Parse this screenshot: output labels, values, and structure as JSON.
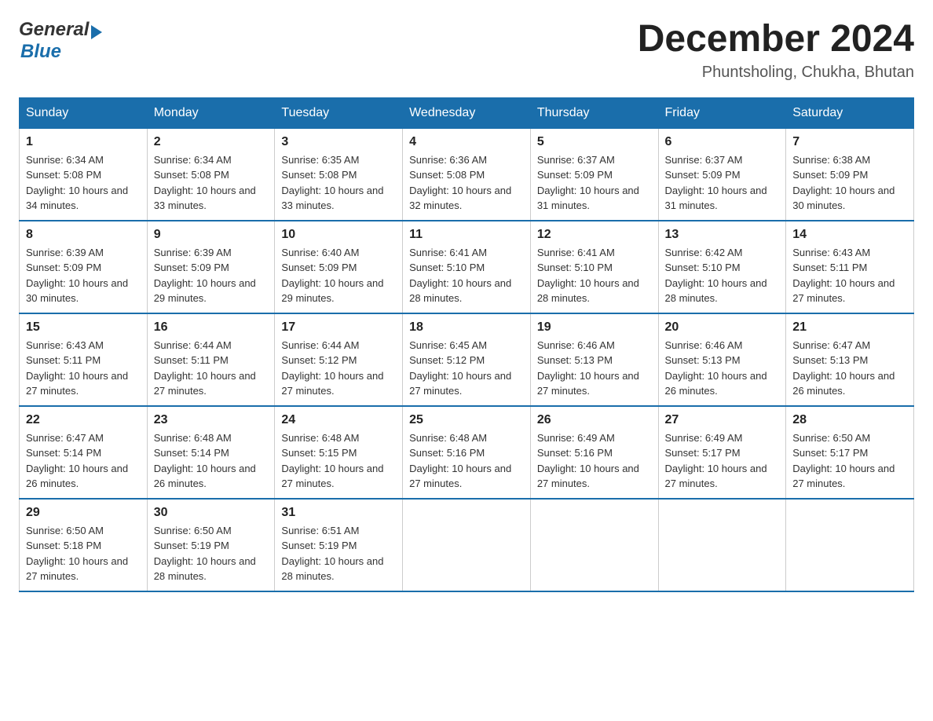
{
  "header": {
    "logo_general": "General",
    "logo_blue": "Blue",
    "title": "December 2024",
    "location": "Phuntsholing, Chukha, Bhutan"
  },
  "days_of_week": [
    "Sunday",
    "Monday",
    "Tuesday",
    "Wednesday",
    "Thursday",
    "Friday",
    "Saturday"
  ],
  "weeks": [
    [
      {
        "day": "1",
        "sunrise": "6:34 AM",
        "sunset": "5:08 PM",
        "daylight": "10 hours and 34 minutes."
      },
      {
        "day": "2",
        "sunrise": "6:34 AM",
        "sunset": "5:08 PM",
        "daylight": "10 hours and 33 minutes."
      },
      {
        "day": "3",
        "sunrise": "6:35 AM",
        "sunset": "5:08 PM",
        "daylight": "10 hours and 33 minutes."
      },
      {
        "day": "4",
        "sunrise": "6:36 AM",
        "sunset": "5:08 PM",
        "daylight": "10 hours and 32 minutes."
      },
      {
        "day": "5",
        "sunrise": "6:37 AM",
        "sunset": "5:09 PM",
        "daylight": "10 hours and 31 minutes."
      },
      {
        "day": "6",
        "sunrise": "6:37 AM",
        "sunset": "5:09 PM",
        "daylight": "10 hours and 31 minutes."
      },
      {
        "day": "7",
        "sunrise": "6:38 AM",
        "sunset": "5:09 PM",
        "daylight": "10 hours and 30 minutes."
      }
    ],
    [
      {
        "day": "8",
        "sunrise": "6:39 AM",
        "sunset": "5:09 PM",
        "daylight": "10 hours and 30 minutes."
      },
      {
        "day": "9",
        "sunrise": "6:39 AM",
        "sunset": "5:09 PM",
        "daylight": "10 hours and 29 minutes."
      },
      {
        "day": "10",
        "sunrise": "6:40 AM",
        "sunset": "5:09 PM",
        "daylight": "10 hours and 29 minutes."
      },
      {
        "day": "11",
        "sunrise": "6:41 AM",
        "sunset": "5:10 PM",
        "daylight": "10 hours and 28 minutes."
      },
      {
        "day": "12",
        "sunrise": "6:41 AM",
        "sunset": "5:10 PM",
        "daylight": "10 hours and 28 minutes."
      },
      {
        "day": "13",
        "sunrise": "6:42 AM",
        "sunset": "5:10 PM",
        "daylight": "10 hours and 28 minutes."
      },
      {
        "day": "14",
        "sunrise": "6:43 AM",
        "sunset": "5:11 PM",
        "daylight": "10 hours and 27 minutes."
      }
    ],
    [
      {
        "day": "15",
        "sunrise": "6:43 AM",
        "sunset": "5:11 PM",
        "daylight": "10 hours and 27 minutes."
      },
      {
        "day": "16",
        "sunrise": "6:44 AM",
        "sunset": "5:11 PM",
        "daylight": "10 hours and 27 minutes."
      },
      {
        "day": "17",
        "sunrise": "6:44 AM",
        "sunset": "5:12 PM",
        "daylight": "10 hours and 27 minutes."
      },
      {
        "day": "18",
        "sunrise": "6:45 AM",
        "sunset": "5:12 PM",
        "daylight": "10 hours and 27 minutes."
      },
      {
        "day": "19",
        "sunrise": "6:46 AM",
        "sunset": "5:13 PM",
        "daylight": "10 hours and 27 minutes."
      },
      {
        "day": "20",
        "sunrise": "6:46 AM",
        "sunset": "5:13 PM",
        "daylight": "10 hours and 26 minutes."
      },
      {
        "day": "21",
        "sunrise": "6:47 AM",
        "sunset": "5:13 PM",
        "daylight": "10 hours and 26 minutes."
      }
    ],
    [
      {
        "day": "22",
        "sunrise": "6:47 AM",
        "sunset": "5:14 PM",
        "daylight": "10 hours and 26 minutes."
      },
      {
        "day": "23",
        "sunrise": "6:48 AM",
        "sunset": "5:14 PM",
        "daylight": "10 hours and 26 minutes."
      },
      {
        "day": "24",
        "sunrise": "6:48 AM",
        "sunset": "5:15 PM",
        "daylight": "10 hours and 27 minutes."
      },
      {
        "day": "25",
        "sunrise": "6:48 AM",
        "sunset": "5:16 PM",
        "daylight": "10 hours and 27 minutes."
      },
      {
        "day": "26",
        "sunrise": "6:49 AM",
        "sunset": "5:16 PM",
        "daylight": "10 hours and 27 minutes."
      },
      {
        "day": "27",
        "sunrise": "6:49 AM",
        "sunset": "5:17 PM",
        "daylight": "10 hours and 27 minutes."
      },
      {
        "day": "28",
        "sunrise": "6:50 AM",
        "sunset": "5:17 PM",
        "daylight": "10 hours and 27 minutes."
      }
    ],
    [
      {
        "day": "29",
        "sunrise": "6:50 AM",
        "sunset": "5:18 PM",
        "daylight": "10 hours and 27 minutes."
      },
      {
        "day": "30",
        "sunrise": "6:50 AM",
        "sunset": "5:19 PM",
        "daylight": "10 hours and 28 minutes."
      },
      {
        "day": "31",
        "sunrise": "6:51 AM",
        "sunset": "5:19 PM",
        "daylight": "10 hours and 28 minutes."
      },
      null,
      null,
      null,
      null
    ]
  ],
  "labels": {
    "sunrise": "Sunrise:",
    "sunset": "Sunset:",
    "daylight": "Daylight:"
  }
}
